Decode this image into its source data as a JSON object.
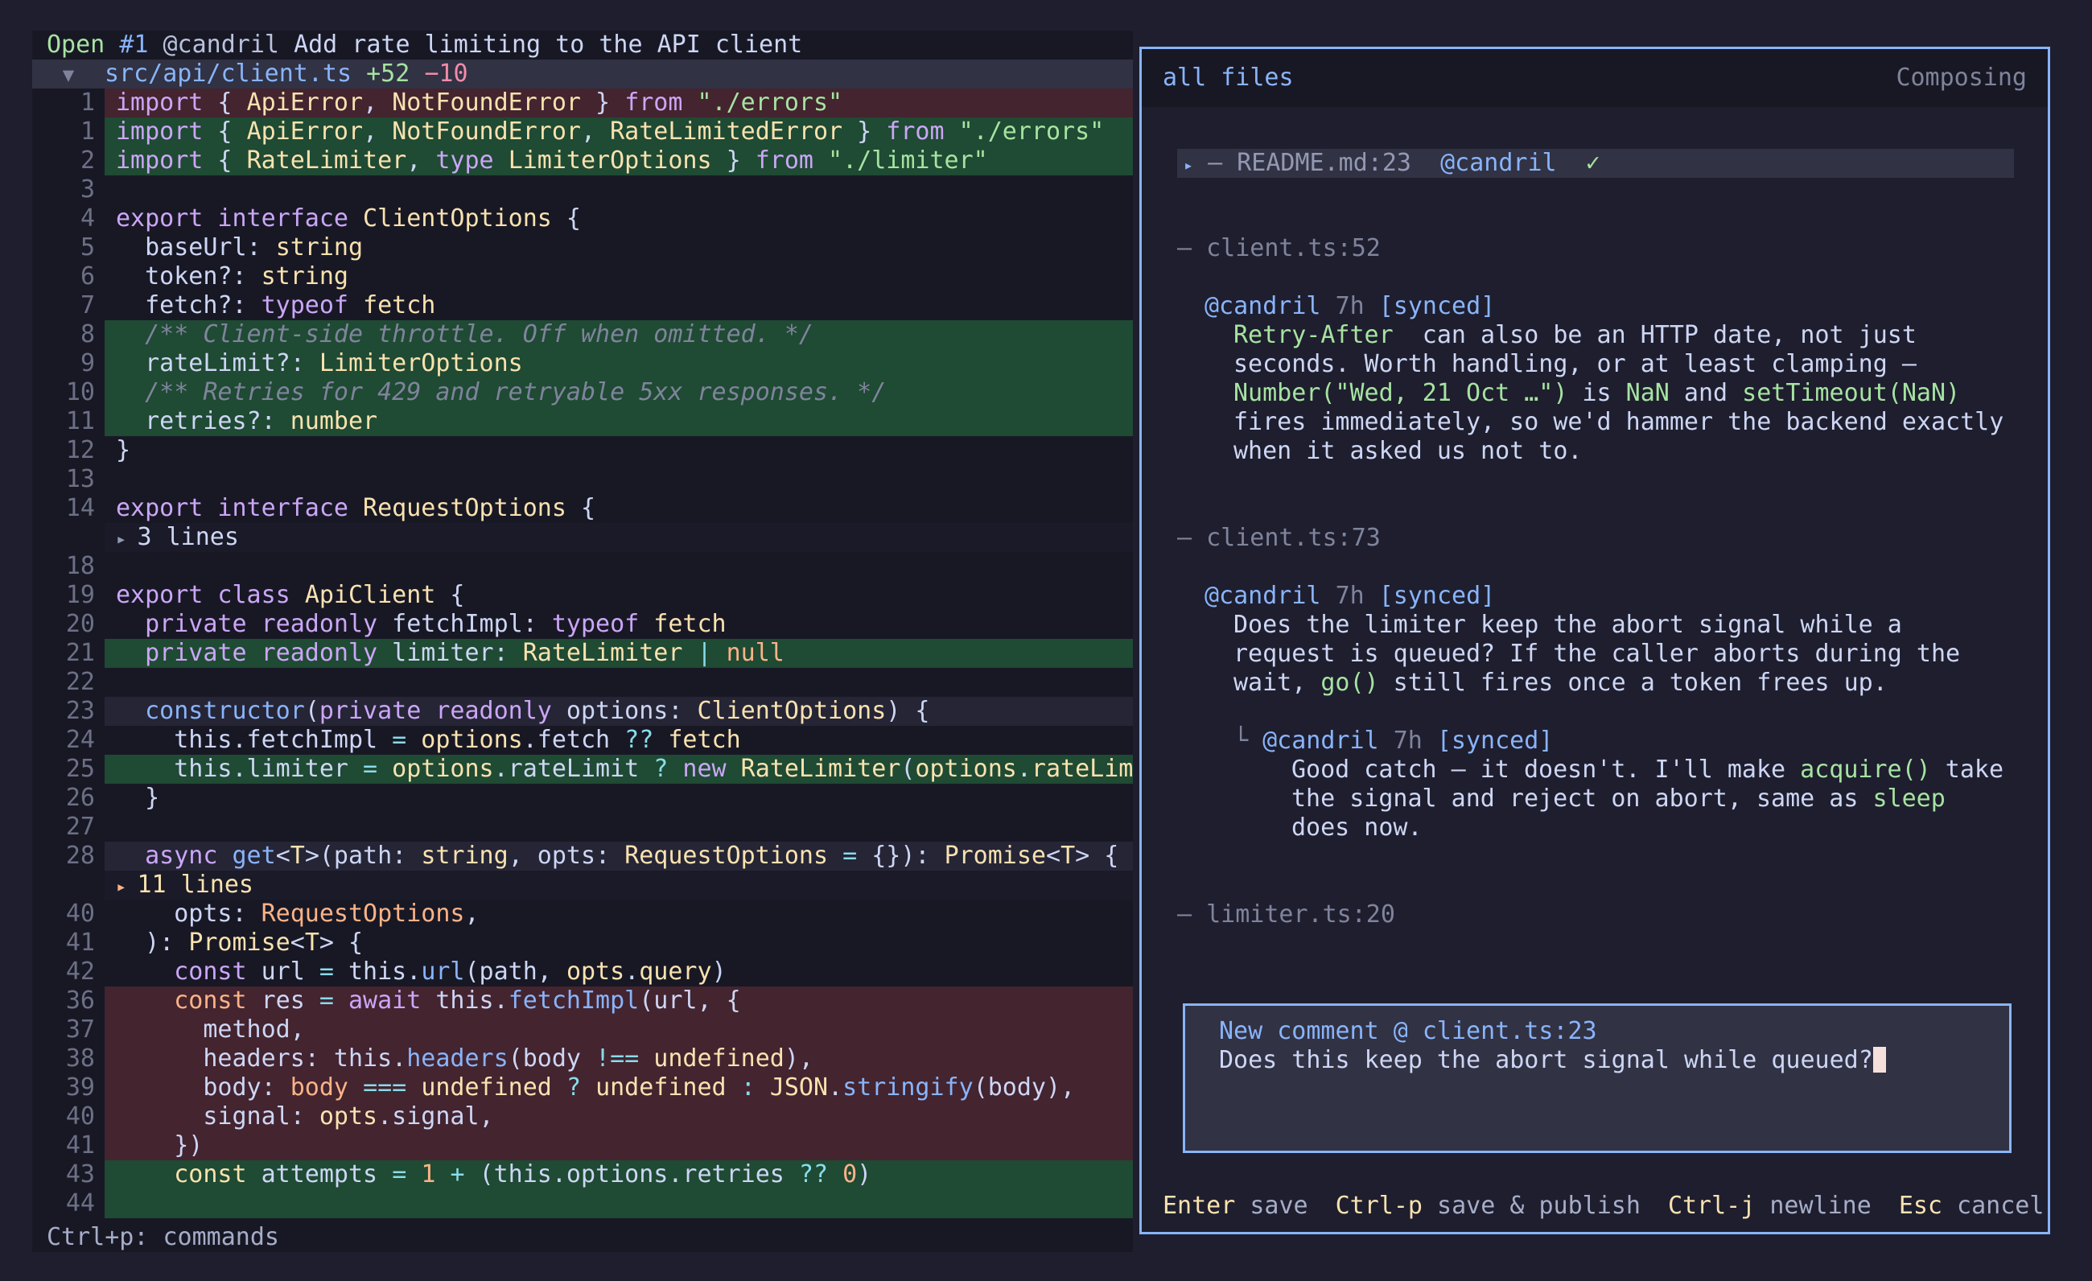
{
  "pr": {
    "state": "Open",
    "number": "#1",
    "author": "@candril",
    "title": "Add rate limiting to the API client"
  },
  "file": {
    "path": "src/api/client.ts",
    "added": "+52",
    "removed": "−10"
  },
  "code_lines": [
    {
      "n": "1",
      "kind": "removed",
      "t": [
        [
          "kw",
          "import"
        ],
        [
          "id",
          " { "
        ],
        [
          "ty",
          "ApiError"
        ],
        [
          "id",
          ", "
        ],
        [
          "ty",
          "NotFoundError"
        ],
        [
          "id",
          " } "
        ],
        [
          "kw",
          "from"
        ],
        [
          "st",
          " \"./errors\""
        ]
      ]
    },
    {
      "n": "1",
      "kind": "added",
      "t": [
        [
          "kw",
          "import"
        ],
        [
          "id",
          " { "
        ],
        [
          "ty",
          "ApiError"
        ],
        [
          "id",
          ", "
        ],
        [
          "ty",
          "NotFoundError"
        ],
        [
          "id",
          ", "
        ],
        [
          "ty",
          "RateLimitedError"
        ],
        [
          "id",
          " } "
        ],
        [
          "kw",
          "from"
        ],
        [
          "st",
          " \"./errors\""
        ]
      ]
    },
    {
      "n": "2",
      "kind": "added",
      "t": [
        [
          "kw",
          "import"
        ],
        [
          "id",
          " { "
        ],
        [
          "ty",
          "RateLimiter"
        ],
        [
          "id",
          ", "
        ],
        [
          "kw",
          "type "
        ],
        [
          "ty",
          "LimiterOptions"
        ],
        [
          "id",
          " } "
        ],
        [
          "kw",
          "from"
        ],
        [
          "st",
          " \"./limiter\""
        ]
      ]
    },
    {
      "n": "3",
      "kind": "ctx",
      "t": []
    },
    {
      "n": "4",
      "kind": "ctx",
      "t": [
        [
          "kw",
          "export interface "
        ],
        [
          "ty",
          "ClientOptions"
        ],
        [
          "id",
          " {"
        ]
      ]
    },
    {
      "n": "5",
      "kind": "ctx",
      "t": [
        [
          "id",
          "  baseUrl: "
        ],
        [
          "ty",
          "string"
        ]
      ]
    },
    {
      "n": "6",
      "kind": "ctx",
      "t": [
        [
          "id",
          "  token?: "
        ],
        [
          "ty",
          "string"
        ]
      ]
    },
    {
      "n": "7",
      "kind": "ctx",
      "t": [
        [
          "id",
          "  fetch?: "
        ],
        [
          "kw",
          "typeof "
        ],
        [
          "ty",
          "fetch"
        ]
      ]
    },
    {
      "n": "8",
      "kind": "added",
      "t": [
        [
          "cm",
          "  /** Client-side throttle. Off when omitted. */"
        ]
      ]
    },
    {
      "n": "9",
      "kind": "added",
      "t": [
        [
          "id",
          "  rateLimit?: "
        ],
        [
          "ty",
          "LimiterOptions"
        ]
      ]
    },
    {
      "n": "10",
      "kind": "added",
      "t": [
        [
          "cm",
          "  /** Retries for 429 and retryable 5xx responses. */"
        ]
      ]
    },
    {
      "n": "11",
      "kind": "added",
      "t": [
        [
          "id",
          "  retries?: "
        ],
        [
          "ty",
          "number"
        ]
      ]
    },
    {
      "n": "12",
      "kind": "ctx",
      "t": [
        [
          "id",
          "}"
        ]
      ]
    },
    {
      "n": "13",
      "kind": "ctx",
      "t": []
    },
    {
      "n": "14",
      "kind": "ctx",
      "t": [
        [
          "kw",
          "export interface "
        ],
        [
          "ty",
          "RequestOptions"
        ],
        [
          "id",
          " {"
        ]
      ]
    },
    {
      "n": "",
      "kind": "fold",
      "t": [
        [
          "fold-tri",
          "▸ "
        ],
        [
          "id",
          "3 lines"
        ]
      ]
    },
    {
      "n": "18",
      "kind": "ctx",
      "t": []
    },
    {
      "n": "19",
      "kind": "ctx",
      "t": [
        [
          "kw",
          "export class "
        ],
        [
          "ty",
          "ApiClient"
        ],
        [
          "id",
          " {"
        ]
      ]
    },
    {
      "n": "20",
      "kind": "ctx",
      "t": [
        [
          "kw",
          "  private readonly "
        ],
        [
          "id",
          "fetchImpl: "
        ],
        [
          "kw",
          "typeof "
        ],
        [
          "ty",
          "fetch"
        ]
      ]
    },
    {
      "n": "21",
      "kind": "added",
      "t": [
        [
          "kw",
          "  private readonly "
        ],
        [
          "id",
          "limiter: "
        ],
        [
          "ty",
          "RateLimiter"
        ],
        [
          "op",
          " | "
        ],
        [
          "nm",
          "null"
        ]
      ]
    },
    {
      "n": "22",
      "kind": "ctx",
      "t": []
    },
    {
      "n": "23",
      "kind": "cursor",
      "t": [
        [
          "fn",
          "  constructor"
        ],
        [
          "id",
          "("
        ],
        [
          "kw",
          "private readonly "
        ],
        [
          "id",
          "options: "
        ],
        [
          "ty",
          "ClientOptions"
        ],
        [
          "id",
          ") {"
        ]
      ]
    },
    {
      "n": "24",
      "kind": "ctx",
      "t": [
        [
          "id",
          "    this.fetchImpl "
        ],
        [
          "op",
          "= "
        ],
        [
          "ty",
          "options"
        ],
        [
          "id",
          ".fetch "
        ],
        [
          "op",
          "?? "
        ],
        [
          "ty",
          "fetch"
        ]
      ]
    },
    {
      "n": "25",
      "kind": "added",
      "t": [
        [
          "id",
          "    this.limiter "
        ],
        [
          "op",
          "= "
        ],
        [
          "ty",
          "options"
        ],
        [
          "id",
          ".rateLimit "
        ],
        [
          "op",
          "? "
        ],
        [
          "kw",
          "new "
        ],
        [
          "ty",
          "RateLimiter"
        ],
        [
          "id",
          "("
        ],
        [
          "ty",
          "options"
        ],
        [
          "id",
          "."
        ],
        [
          "ty",
          "rateLim"
        ]
      ]
    },
    {
      "n": "26",
      "kind": "ctx",
      "t": [
        [
          "id",
          "  }"
        ]
      ]
    },
    {
      "n": "27",
      "kind": "ctx",
      "t": []
    },
    {
      "n": "28",
      "kind": "cursor",
      "t": [
        [
          "kw",
          "  async "
        ],
        [
          "fn",
          "get"
        ],
        [
          "id",
          "<"
        ],
        [
          "ty",
          "T"
        ],
        [
          "id",
          ">(path: "
        ],
        [
          "ty",
          "string"
        ],
        [
          "id",
          ", opts: "
        ],
        [
          "ty",
          "RequestOptions"
        ],
        [
          "op",
          " = "
        ],
        [
          "id",
          "{}): "
        ],
        [
          "ty",
          "Promise"
        ],
        [
          "id",
          "<"
        ],
        [
          "ty",
          "T"
        ],
        [
          "id",
          "> {"
        ]
      ]
    },
    {
      "n": "",
      "kind": "fold-hl",
      "t": [
        [
          "fold-tri-hl",
          "▸ "
        ],
        [
          "fold-text-hl",
          "11 lines"
        ]
      ]
    },
    {
      "n": "40",
      "kind": "ctx",
      "t": [
        [
          "id",
          "    opts: "
        ],
        [
          "nm",
          "RequestOptions"
        ],
        [
          "id",
          ","
        ]
      ]
    },
    {
      "n": "41",
      "kind": "ctx",
      "t": [
        [
          "id",
          "  ): "
        ],
        [
          "ty",
          "Promise"
        ],
        [
          "id",
          "<"
        ],
        [
          "ty",
          "T"
        ],
        [
          "id",
          "> {"
        ]
      ]
    },
    {
      "n": "42",
      "kind": "ctx",
      "t": [
        [
          "kw",
          "    const "
        ],
        [
          "id",
          "url "
        ],
        [
          "op",
          "= "
        ],
        [
          "id",
          "this."
        ],
        [
          "fn",
          "url"
        ],
        [
          "id",
          "(path, "
        ],
        [
          "ty",
          "opts"
        ],
        [
          "id",
          "."
        ],
        [
          "ty",
          "query"
        ],
        [
          "id",
          ")"
        ]
      ]
    },
    {
      "n": "36",
      "kind": "removed",
      "t": [
        [
          "nm",
          "    const "
        ],
        [
          "id",
          "res "
        ],
        [
          "op",
          "= "
        ],
        [
          "kw",
          "await "
        ],
        [
          "id",
          "this."
        ],
        [
          "fn",
          "fetchImpl"
        ],
        [
          "id",
          "(url, {"
        ]
      ]
    },
    {
      "n": "37",
      "kind": "removed",
      "t": [
        [
          "id",
          "      method,"
        ]
      ]
    },
    {
      "n": "38",
      "kind": "removed",
      "t": [
        [
          "id",
          "      headers: this."
        ],
        [
          "fn",
          "headers"
        ],
        [
          "id",
          "(body "
        ],
        [
          "op",
          "!== "
        ],
        [
          "ty",
          "undefined"
        ],
        [
          "id",
          "),"
        ]
      ]
    },
    {
      "n": "39",
      "kind": "removed",
      "t": [
        [
          "id",
          "      body: "
        ],
        [
          "nm",
          "body "
        ],
        [
          "op",
          "=== "
        ],
        [
          "ty",
          "undefined "
        ],
        [
          "op",
          "? "
        ],
        [
          "ty",
          "undefined "
        ],
        [
          "op",
          ": "
        ],
        [
          "ty",
          "JSON"
        ],
        [
          "id",
          "."
        ],
        [
          "fn",
          "stringify"
        ],
        [
          "id",
          "(body),"
        ]
      ]
    },
    {
      "n": "40",
      "kind": "removed",
      "t": [
        [
          "id",
          "      signal: "
        ],
        [
          "ty",
          "opts"
        ],
        [
          "id",
          ".signal,"
        ]
      ]
    },
    {
      "n": "41",
      "kind": "removed",
      "t": [
        [
          "id",
          "    })"
        ]
      ]
    },
    {
      "n": "43",
      "kind": "added",
      "t": [
        [
          "ty",
          "    const "
        ],
        [
          "id",
          "attempts "
        ],
        [
          "op",
          "= "
        ],
        [
          "nm",
          "1 "
        ],
        [
          "op",
          "+ "
        ],
        [
          "id",
          "(this.options.retries "
        ],
        [
          "op",
          "?? "
        ],
        [
          "nm",
          "0"
        ],
        [
          "id",
          ")"
        ]
      ]
    },
    {
      "n": "44",
      "kind": "added",
      "t": []
    }
  ],
  "status_bar": {
    "hint": "Ctrl+p: commands"
  },
  "panel": {
    "scope": "all files",
    "mode": "Composing"
  },
  "threads": {
    "readme": {
      "tri": "▸",
      "title": "– README.md:23",
      "author": "@candril",
      "check": "✓"
    },
    "t1": {
      "title": "– client.ts:52",
      "author": "@candril",
      "age": "7h",
      "sync": "[synced]",
      "lines": [
        [
          [
            "code",
            "Retry-After"
          ],
          [
            "",
            "  can also be an HTTP date, not just"
          ]
        ],
        [
          [
            "",
            "seconds. Worth handling, or at least clamping —"
          ]
        ],
        [
          [
            "code",
            "Number(\"Wed, 21 Oct …\")"
          ],
          [
            "",
            " is "
          ],
          [
            "code",
            "NaN"
          ],
          [
            "",
            " and "
          ],
          [
            "code",
            "setTimeout(NaN)"
          ]
        ],
        [
          [
            "",
            "fires immediately, so we'd hammer the backend exactly"
          ]
        ],
        [
          [
            "",
            "when it asked us not to."
          ]
        ]
      ]
    },
    "t2": {
      "title": "– client.ts:73",
      "author": "@candril",
      "age": "7h",
      "sync": "[synced]",
      "lines": [
        [
          [
            "",
            "Does the limiter keep the abort signal while a"
          ]
        ],
        [
          [
            "",
            "request is queued? If the caller aborts during the"
          ]
        ],
        [
          [
            "",
            "wait, "
          ],
          [
            "code",
            "go()"
          ],
          [
            "",
            " still fires once a token frees up."
          ]
        ]
      ],
      "reply": {
        "corner": "└",
        "author": "@candril",
        "age": "7h",
        "sync": "[synced]",
        "lines": [
          [
            [
              "",
              "Good catch — it doesn't. I'll make "
            ],
            [
              "code",
              "acquire()"
            ],
            [
              "",
              " take"
            ]
          ],
          [
            [
              "",
              "the signal and reject on abort, same as "
            ],
            [
              "code",
              "sleep"
            ]
          ],
          [
            [
              "",
              "does now."
            ]
          ]
        ]
      }
    },
    "t3": {
      "title": "– limiter.ts:20"
    }
  },
  "composer": {
    "label": "New comment @ client.ts:23",
    "text": "Does this keep the abort signal while queued?"
  },
  "help": [
    {
      "key": "Enter",
      "action": "save"
    },
    {
      "key": "Ctrl-p",
      "action": "save & publish"
    },
    {
      "key": "Ctrl-j",
      "action": "newline"
    },
    {
      "key": "Esc",
      "action": "cancel"
    }
  ]
}
